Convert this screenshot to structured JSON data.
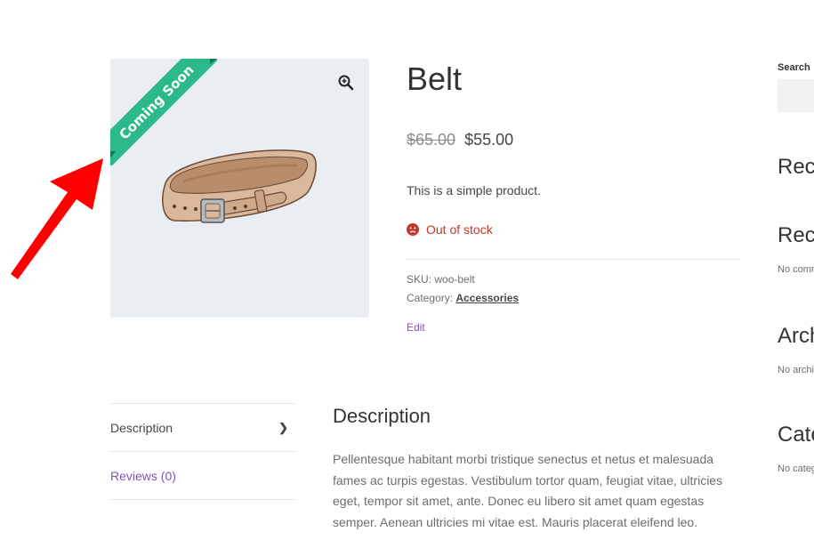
{
  "product": {
    "badge": "Coming Soon",
    "title": "Belt",
    "old_price": "$65.00",
    "price": "$55.00",
    "short_description": "This is a simple product.",
    "stock_status": "Out of stock",
    "sku_label": "SKU:",
    "sku": "woo-belt",
    "category_label": "Category:",
    "category": "Accessories",
    "edit_label": "Edit"
  },
  "tabs": [
    {
      "label": "Description"
    },
    {
      "label": "Reviews (0)"
    }
  ],
  "description": {
    "heading": "Description",
    "body": "Pellentesque habitant morbi tristique senectus et netus et malesuada fames ac turpis egestas. Vestibulum tortor quam, feugiat vitae, ultricies eget, tempor sit amet, ante. Donec eu libero sit amet quam egestas semper. Aenean ultricies mi vitae est. Mauris placerat eleifend leo."
  },
  "sidebar": {
    "search_label": "Search",
    "recent_posts": "Rece",
    "recent_comments": "Rece",
    "no_comments": "No comm",
    "archives": "Arch",
    "no_archives": "No archi",
    "categories": "Cate",
    "no_categories": "No categ"
  },
  "colors": {
    "ribbon": "#2bb98b",
    "accent": "#7f54b3",
    "out_of_stock": "#c0392b",
    "arrow": "#ff0000"
  }
}
